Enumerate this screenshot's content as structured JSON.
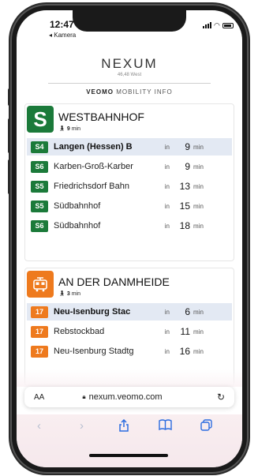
{
  "status_bar": {
    "time": "12:47",
    "back_app": "◂ Kamera"
  },
  "header": {
    "brand": "NEXUM",
    "brand_sub": "46,48 West",
    "mobility_brand": "VEOMO",
    "mobility_suffix": "MOBILITY INFO"
  },
  "stations": [
    {
      "logo": "S",
      "name": "WESTBAHNHOF",
      "walk_minutes": "9",
      "walk_unit": "min",
      "departures": [
        {
          "line": "S4",
          "destination": "Langen (Hessen) B",
          "in": "in",
          "minutes": "9",
          "unit": "min",
          "highlight": true
        },
        {
          "line": "S6",
          "destination": "Karben-Groß-Karber",
          "in": "in",
          "minutes": "9",
          "unit": "min",
          "highlight": false
        },
        {
          "line": "S5",
          "destination": "Friedrichsdorf Bahn",
          "in": "in",
          "minutes": "13",
          "unit": "min",
          "highlight": false
        },
        {
          "line": "S5",
          "destination": "Südbahnhof",
          "in": "in",
          "minutes": "15",
          "unit": "min",
          "highlight": false
        },
        {
          "line": "S6",
          "destination": "Südbahnhof",
          "in": "in",
          "minutes": "18",
          "unit": "min",
          "highlight": false
        }
      ]
    },
    {
      "logo": "tram-icon",
      "name": "AN DER DANMHEIDE",
      "walk_minutes": "3",
      "walk_unit": "min",
      "departures": [
        {
          "line": "17",
          "destination": "Neu-Isenburg Stac",
          "in": "in",
          "minutes": "6",
          "unit": "min",
          "highlight": true
        },
        {
          "line": "17",
          "destination": "Rebstockbad",
          "in": "in",
          "minutes": "11",
          "unit": "min",
          "highlight": false
        },
        {
          "line": "17",
          "destination": "Neu-Isenburg Stadtg",
          "in": "in",
          "minutes": "16",
          "unit": "min",
          "highlight": false
        }
      ]
    }
  ],
  "browser": {
    "text_size": "AA",
    "url": "nexum.veomo.com"
  },
  "colors": {
    "sbahn_green": "#1b7a3a",
    "tram_orange": "#ee7a1e",
    "highlight_row": "#e3e9f3",
    "safari_blue": "#2b6ce0"
  },
  "icons": [
    "walk-icon",
    "tram-icon",
    "lock-icon",
    "reload-icon",
    "back-icon",
    "forward-icon",
    "share-icon",
    "bookmarks-icon",
    "tabs-icon"
  ]
}
